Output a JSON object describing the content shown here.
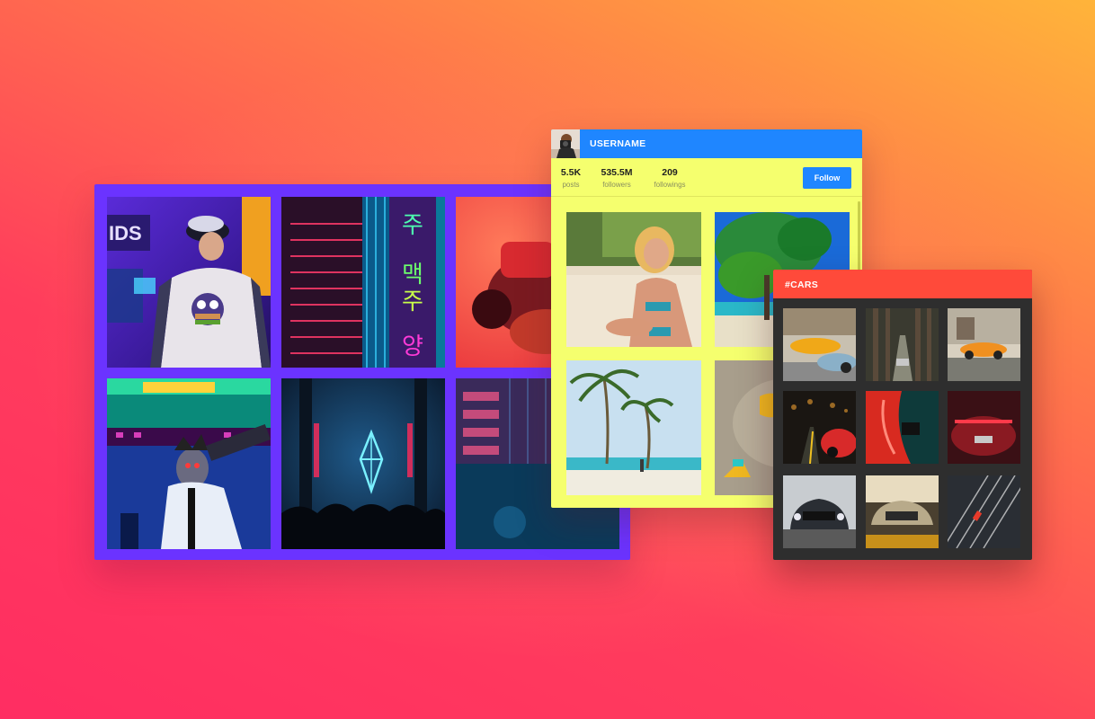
{
  "profile": {
    "username": "USERNAME",
    "stats": [
      {
        "value": "5.5K",
        "label": "posts"
      },
      {
        "value": "535.5M",
        "label": "followers"
      },
      {
        "value": "209",
        "label": "followings"
      }
    ],
    "follow_label": "Follow"
  },
  "hashtag": {
    "title": "#CARS"
  },
  "colors": {
    "purple_widget": "#6b33ff",
    "profile_bg": "#f5ff6e",
    "profile_header": "#1f86ff",
    "cars_header": "#ff4a3a",
    "cars_bg": "#2e2e2e"
  }
}
